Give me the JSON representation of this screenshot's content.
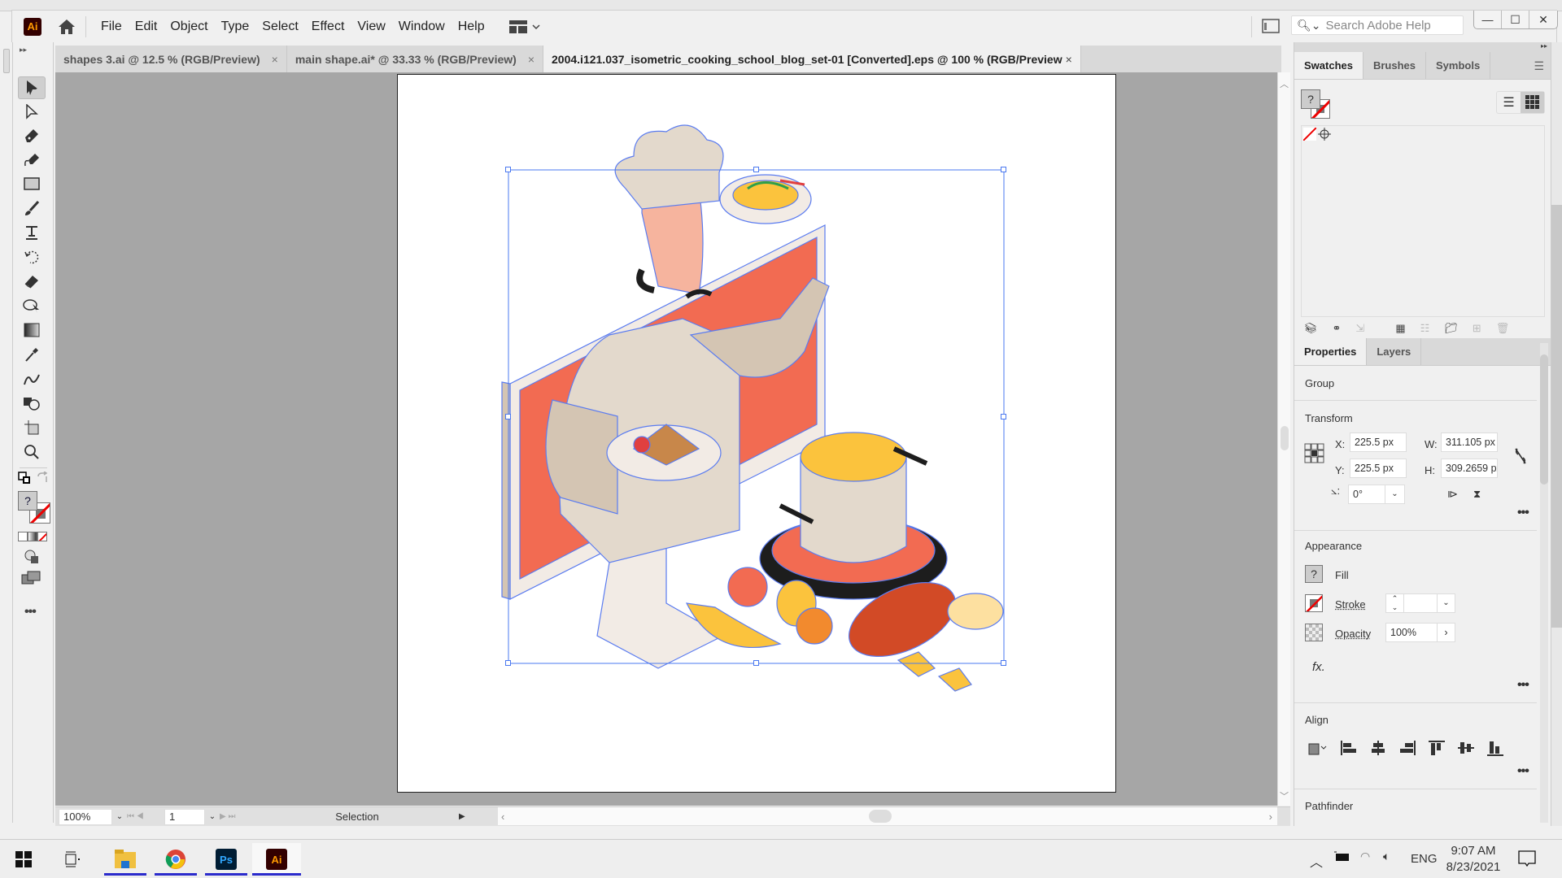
{
  "app": {
    "name": "Adobe Illustrator",
    "logo_text": "Ai"
  },
  "menu": [
    "File",
    "Edit",
    "Object",
    "Type",
    "Select",
    "Effect",
    "View",
    "Window",
    "Help"
  ],
  "search": {
    "placeholder": "Search Adobe Help"
  },
  "window_buttons": {
    "minimize": "—",
    "maximize": "☐",
    "close": "✕"
  },
  "tabs": [
    {
      "label": "shapes 3.ai @ 12.5 % (RGB/Preview)",
      "active": false
    },
    {
      "label": "main shape.ai* @ 33.33 % (RGB/Preview)",
      "active": false
    },
    {
      "label": "2004.i121.037_isometric_cooking_school_blog_set-01 [Converted].eps @ 100 % (RGB/Preview",
      "active": true
    }
  ],
  "tab_close": "×",
  "tools": [
    "selection-tool",
    "direct-selection-tool",
    "pen-tool",
    "curvature-tool",
    "rectangle-tool",
    "paintbrush-tool",
    "type-tool",
    "rotate-tool",
    "eraser-tool",
    "shape-builder-tool",
    "gradient-tool",
    "eyedropper-tool",
    "blend-tool",
    "symbol-sprayer-tool",
    "artboard-tool",
    "zoom-tool"
  ],
  "artwork": {
    "colors": {
      "coral": "#f26b52",
      "beige": "#e3d9cc",
      "tan": "#d4c5b3",
      "skin": "#f6b49e",
      "outline": "#5b7cf0",
      "yellow": "#fbc33d",
      "orange": "#f28a2e",
      "bread": "#d24a26",
      "dark": "#1d1d1d",
      "screen_frame": "#f2ebe5"
    }
  },
  "status": {
    "zoom": "100%",
    "artboard": "1",
    "tool": "Selection"
  },
  "panel_top": {
    "tabs": [
      "Swatches",
      "Brushes",
      "Symbols"
    ],
    "active_tab": "Swatches"
  },
  "panel_props": {
    "tabs": [
      "Properties",
      "Layers"
    ],
    "selection_type": "Group",
    "transform": {
      "title": "Transform",
      "x_label": "X:",
      "x": "225.5 px",
      "y_label": "Y:",
      "y": "225.5 px",
      "w_label": "W:",
      "w": "311.105 px",
      "h_label": "H:",
      "h": "309.2659 px",
      "angle": "0°"
    },
    "appearance": {
      "title": "Appearance",
      "fill": "Fill",
      "stroke": "Stroke",
      "stroke_value": "",
      "opacity": "Opacity",
      "opacity_value": "100%",
      "fx": "fx."
    },
    "align": {
      "title": "Align"
    },
    "pathfinder": {
      "title": "Pathfinder"
    }
  },
  "taskbar": {
    "apps": [
      "File Explorer",
      "Google Chrome",
      "Photoshop",
      "Illustrator"
    ],
    "lang": "ENG",
    "time": "9:07 AM",
    "date": "8/23/2021"
  }
}
